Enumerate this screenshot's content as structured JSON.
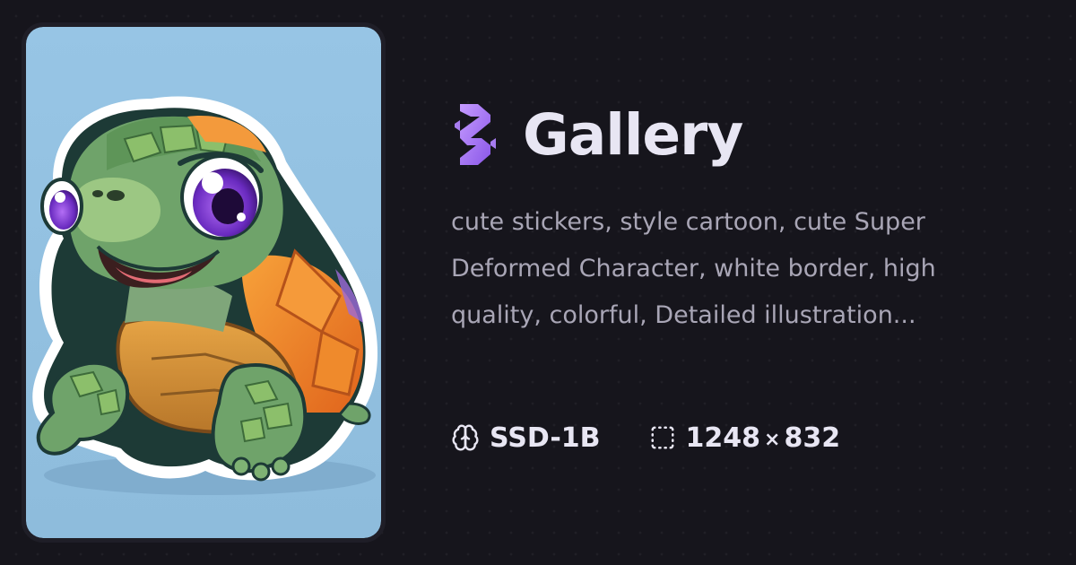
{
  "header": {
    "logo_icon": "gallery-logo-icon",
    "title": "Gallery"
  },
  "prompt": {
    "text": "cute stickers, style cartoon, cute Super Deformed Character, white border, high quality, colorful, Detailed illustration..."
  },
  "meta": {
    "model_icon": "brain-icon",
    "model": "SSD-1B",
    "size_icon": "dashed-frame-icon",
    "width": "1248",
    "times": "×",
    "height": "832"
  },
  "image": {
    "subject": "cute cartoon turtle sticker",
    "icon": "turtle-sticker-image"
  },
  "colors": {
    "background": "#16151c",
    "accent": "#a77cf0",
    "title": "#e8e6f3",
    "prompt_text": "#a9a6b6",
    "image_backdrop": "#93c1e0"
  }
}
